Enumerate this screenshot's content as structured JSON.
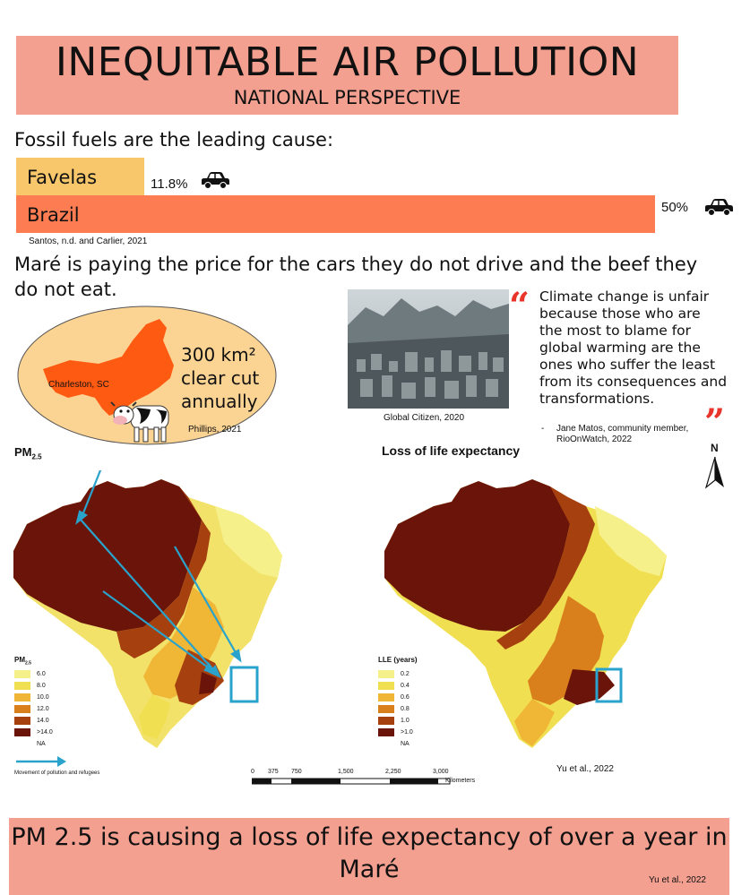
{
  "header": {
    "title": "INEQUITABLE AIR POLLUTION",
    "subtitle": "NATIONAL PERSPECTIVE"
  },
  "fossil": {
    "lead": "Fossil fuels are the leading cause:",
    "bars": [
      {
        "label": "Favelas",
        "value_text": "11.8%",
        "value": 11.8,
        "color": "#f8c76b"
      },
      {
        "label": "Brazil",
        "value_text": "50%",
        "value": 50,
        "color": "#fd7c52"
      }
    ],
    "source": "Santos, n.d. and Carlier, 2021"
  },
  "statement": "Maré is paying the price for the cars they do not drive and the beef they do not eat.",
  "bubble": {
    "city": "Charleston, SC",
    "clearcut_line1": "300 km²",
    "clearcut_line2": "clear cut",
    "clearcut_line3": "annually",
    "source": "Phillips, 2021"
  },
  "photo": {
    "caption": "Global Citizen, 2020"
  },
  "quote": {
    "text": "Climate change is unfair because those who are the most to blame for global warming are the ones who suffer the least from its consequences and transformations.",
    "dash": "-",
    "attribution": "Jane Matos, community member, RioOnWatch, 2022"
  },
  "maps": {
    "left_title": "PM",
    "left_title_sub": "2.5",
    "right_title": "Loss of life expectancy",
    "north": "N",
    "pm_legend": {
      "title": "PM",
      "title_sub": "2.5",
      "items": [
        {
          "label": "6.0",
          "color": "#f6f08a"
        },
        {
          "label": "8.0",
          "color": "#f1df52"
        },
        {
          "label": "10.0",
          "color": "#f0b636"
        },
        {
          "label": "12.0",
          "color": "#d97f1c"
        },
        {
          "label": "14.0",
          "color": "#a6400f"
        },
        {
          "label": ">14.0",
          "color": "#6b140a"
        }
      ],
      "na": "NA"
    },
    "lle_legend": {
      "title": "LLE (years)",
      "items": [
        {
          "label": "0.2",
          "color": "#f6f08a"
        },
        {
          "label": "0.4",
          "color": "#f1df52"
        },
        {
          "label": "0.6",
          "color": "#f0b636"
        },
        {
          "label": "0.8",
          "color": "#d97f1c"
        },
        {
          "label": "1.0",
          "color": "#a6400f"
        },
        {
          "label": ">1.0",
          "color": "#6b140a"
        }
      ],
      "na": "NA"
    },
    "arrow_legend": "Movement of pollution and refugees",
    "scale": {
      "ticks": [
        "0",
        "375",
        "750",
        "1,500",
        "2,250",
        "3,000"
      ],
      "unit": "Kilometers"
    },
    "source": "Yu et al., 2022"
  },
  "footer": {
    "text": "PM 2.5 is causing a loss of life expectancy of over a year in Maré",
    "source": "Yu et al., 2022"
  },
  "colors": {
    "salmon": "#f4a090",
    "arrow": "#2aa3cc",
    "quote_red": "#e8342a",
    "amazon_orange": "#ff5a12"
  }
}
